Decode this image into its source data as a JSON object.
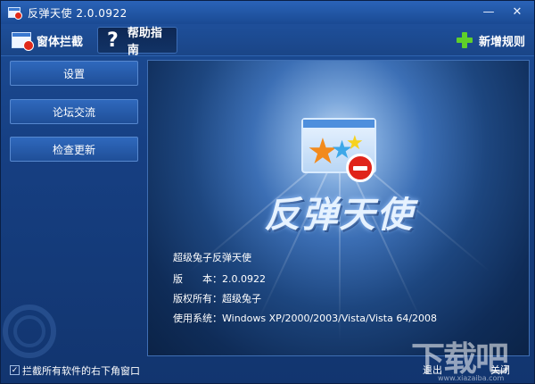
{
  "window": {
    "title": "反弹天使 2.0.0922",
    "minimize_glyph": "—",
    "close_glyph": "✕"
  },
  "toolbar": {
    "intercept_label": "窗体拦截",
    "help_label": "帮助指南",
    "add_rule_label": "新增规则",
    "help_glyph": "?"
  },
  "sidebar": {
    "items": [
      {
        "label": "设置"
      },
      {
        "label": "论坛交流"
      },
      {
        "label": "检查更新"
      }
    ]
  },
  "main": {
    "brand": "反弹天使",
    "info": [
      "超级兔子反弹天使",
      "版　　本：2.0.0922",
      "版权所有：超级兔子",
      "使用系统：Windows XP/2000/2003/Vista/Vista 64/2008"
    ]
  },
  "footer": {
    "checkbox_label": "拦截所有软件的右下角窗口",
    "checkbox_checked": true,
    "check_glyph": "✓",
    "exit_label": "退出",
    "close_label": "关闭"
  },
  "watermark": {
    "text": "下载吧",
    "url": "www.xiazaiba.com"
  },
  "colors": {
    "accent": "#1d4d97",
    "stop_red": "#e0241a",
    "add_green": "#5fcf2a"
  },
  "icons": [
    "app-icon",
    "window-block-icon",
    "help-icon",
    "plus-icon",
    "stop-icon",
    "star-icon"
  ]
}
